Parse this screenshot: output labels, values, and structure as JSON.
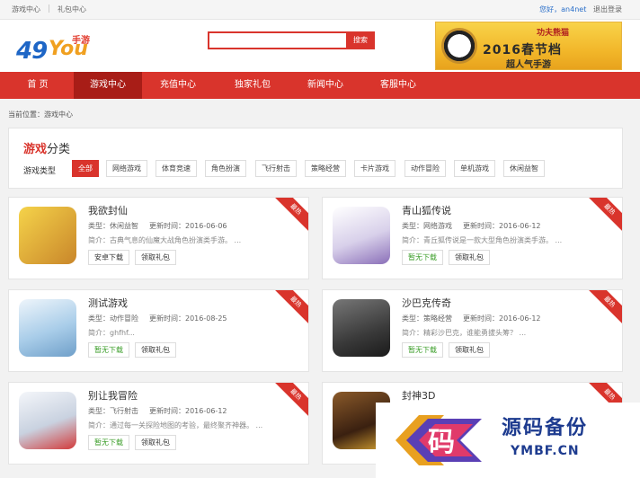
{
  "topbar": {
    "left_links": [
      "游戏中心",
      "礼包中心"
    ],
    "greeting": "您好，",
    "username": "an4net",
    "logout": "退出登录"
  },
  "logo": {
    "num": "49",
    "you": "You",
    "sub": "手游"
  },
  "search": {
    "value": "",
    "button": "搜索"
  },
  "banner": {
    "top": "功夫熊猫",
    "line1": "2016春节档",
    "line2": "超人气手游"
  },
  "nav": {
    "items": [
      "首 页",
      "游戏中心",
      "充值中心",
      "独家礼包",
      "新闻中心",
      "客服中心"
    ],
    "active_index": 1
  },
  "breadcrumb": {
    "label": "当前位置：",
    "current": "游戏中心"
  },
  "category": {
    "title_highlight": "游戏",
    "title_rest": "分类",
    "type_label": "游戏类型",
    "chips": [
      "全部",
      "网络游戏",
      "体育竞速",
      "角色扮演",
      "飞行射击",
      "策略经营",
      "卡片游戏",
      "动作冒险",
      "单机游戏",
      "休闲益智"
    ],
    "active_index": 0
  },
  "card_labels": {
    "type": "类型：",
    "updated": "更新时间：",
    "intro": "简介：",
    "ribbon": "最热",
    "gift": "领取礼包"
  },
  "games": [
    {
      "name": "我欲封仙",
      "type": "休闲益智",
      "updated": "2016-06-06",
      "intro": "古典气息的仙魔大战角色扮演类手游。 ...",
      "download": "安卓下载",
      "download_available": true,
      "accent": "#f0c040"
    },
    {
      "name": "青山狐传说",
      "type": "网络游戏",
      "updated": "2016-06-12",
      "intro": "青丘狐传说是一款大型角色扮演类手游。 ...",
      "download": "暂无下载",
      "download_available": false,
      "accent": "#b8a9d6"
    },
    {
      "name": "测试游戏",
      "type": "动作冒险",
      "updated": "2016-08-25",
      "intro": "ghfhf...",
      "download": "暂无下载",
      "download_available": false,
      "accent": "#9ec6e8"
    },
    {
      "name": "沙巴克传奇",
      "type": "策略经营",
      "updated": "2016-06-12",
      "intro": "精彩沙巴克，谁能勇拔头筹？ ...",
      "download": "暂无下载",
      "download_available": false,
      "accent": "#555555"
    },
    {
      "name": "别让我冒险",
      "type": "飞行射击",
      "updated": "2016-06-12",
      "intro": "通过每一关探险地图的考验，最终聚齐神器。 ...",
      "download": "暂无下载",
      "download_available": false,
      "accent": "#e0e6ef"
    },
    {
      "name": "封神3D",
      "type": "",
      "updated": "",
      "intro": "",
      "download": "",
      "download_available": false,
      "accent": "#5a3a1a"
    }
  ],
  "watermark": {
    "glyph": "码",
    "title": "源码备份",
    "domain": "YMBF.CN"
  }
}
